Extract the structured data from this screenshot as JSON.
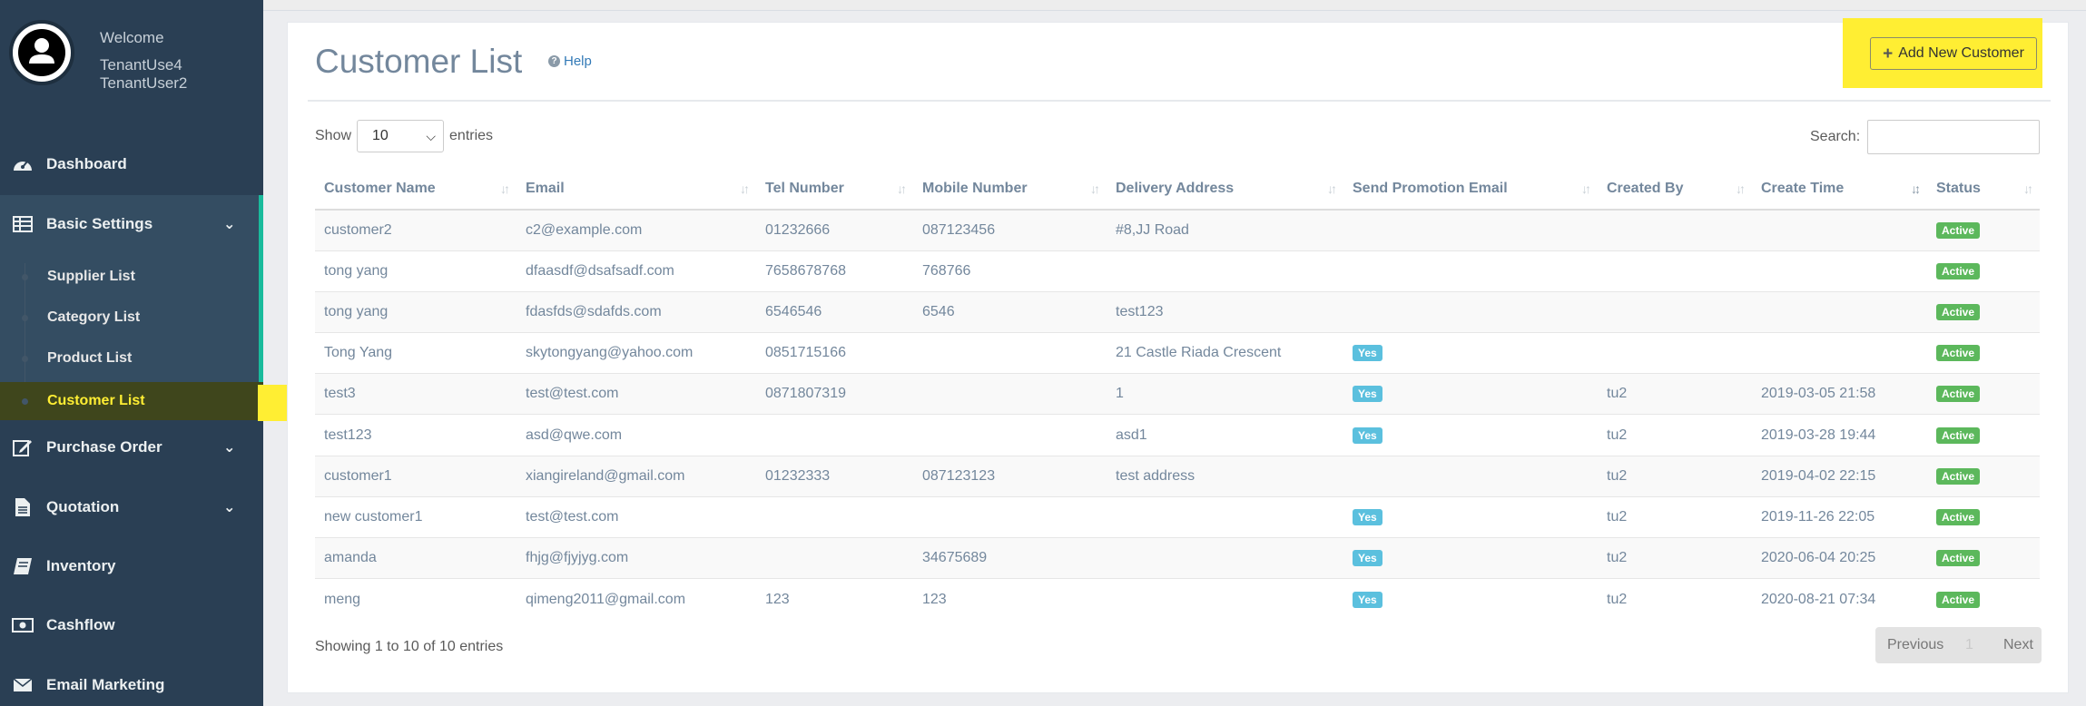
{
  "sidebar": {
    "welcome": "Welcome",
    "user_line1": "TenantUse4",
    "user_line2": "TenantUser2",
    "items": [
      {
        "label": "Dashboard",
        "icon": "dashboard-icon"
      },
      {
        "label": "Basic Settings",
        "icon": "table-icon"
      },
      {
        "label": "Purchase Order",
        "icon": "edit-icon"
      },
      {
        "label": "Quotation",
        "icon": "file-icon"
      },
      {
        "label": "Inventory",
        "icon": "book-icon"
      },
      {
        "label": "Cashflow",
        "icon": "money-icon"
      },
      {
        "label": "Email Marketing",
        "icon": "envelope-icon"
      }
    ],
    "subitems": [
      {
        "label": "Supplier List"
      },
      {
        "label": "Category List"
      },
      {
        "label": "Product List"
      },
      {
        "label": "Customer List"
      }
    ]
  },
  "page": {
    "title": "Customer List",
    "help": "Help",
    "add_button": "Add New Customer"
  },
  "controls": {
    "show": "Show",
    "entries_value": "10",
    "entries": "entries",
    "search_label": "Search:",
    "search_value": ""
  },
  "table": {
    "headers": [
      "Customer Name",
      "Email",
      "Tel Number",
      "Mobile Number",
      "Delivery Address",
      "Send Promotion Email",
      "Created By",
      "Create Time",
      "Status"
    ],
    "rows": [
      {
        "name": "customer2",
        "email": "c2@example.com",
        "tel": "01232666",
        "mobile": "087123456",
        "address": "#8,JJ Road",
        "promo": "",
        "created_by": "",
        "create_time": "",
        "status": "Active"
      },
      {
        "name": "tong yang",
        "email": "dfaasdf@dsafsadf.com",
        "tel": "7658678768",
        "mobile": "768766",
        "address": "",
        "promo": "",
        "created_by": "",
        "create_time": "",
        "status": "Active"
      },
      {
        "name": "tong yang",
        "email": "fdasfds@sdafds.com",
        "tel": "6546546",
        "mobile": "6546",
        "address": "test123",
        "promo": "",
        "created_by": "",
        "create_time": "",
        "status": "Active"
      },
      {
        "name": "Tong Yang",
        "email": "skytongyang@yahoo.com",
        "tel": "0851715166",
        "mobile": "",
        "address": "21 Castle Riada Crescent",
        "promo": "Yes",
        "created_by": "",
        "create_time": "",
        "status": "Active"
      },
      {
        "name": "test3",
        "email": "test@test.com",
        "tel": "0871807319",
        "mobile": "",
        "address": "1",
        "promo": "Yes",
        "created_by": "tu2",
        "create_time": "2019-03-05 21:58",
        "status": "Active"
      },
      {
        "name": "test123",
        "email": "asd@qwe.com",
        "tel": "",
        "mobile": "",
        "address": "asd1",
        "promo": "Yes",
        "created_by": "tu2",
        "create_time": "2019-03-28 19:44",
        "status": "Active"
      },
      {
        "name": "customer1",
        "email": "xiangireland@gmail.com",
        "tel": "01232333",
        "mobile": "087123123",
        "address": "test address",
        "promo": "",
        "created_by": "tu2",
        "create_time": "2019-04-02 22:15",
        "status": "Active"
      },
      {
        "name": "new customer1",
        "email": "test@test.com",
        "tel": "",
        "mobile": "",
        "address": "",
        "promo": "Yes",
        "created_by": "tu2",
        "create_time": "2019-11-26 22:05",
        "status": "Active"
      },
      {
        "name": "amanda",
        "email": "fhjg@fjyjyg.com",
        "tel": "",
        "mobile": "34675689",
        "address": "",
        "promo": "Yes",
        "created_by": "tu2",
        "create_time": "2020-06-04 20:25",
        "status": "Active"
      },
      {
        "name": "meng",
        "email": "qimeng2011@gmail.com",
        "tel": "123",
        "mobile": "123",
        "address": "",
        "promo": "Yes",
        "created_by": "tu2",
        "create_time": "2020-08-21 07:34",
        "status": "Active"
      }
    ]
  },
  "footer": {
    "info": "Showing 1 to 10 of 10 entries",
    "previous": "Previous",
    "page": "1",
    "next": "Next"
  },
  "colors": {
    "sidebar_bg": "#2a3f54",
    "accent": "#1abb9c",
    "highlight": "#ffee33",
    "active_badge": "#5cb85c",
    "yes_badge": "#5bc0de"
  }
}
